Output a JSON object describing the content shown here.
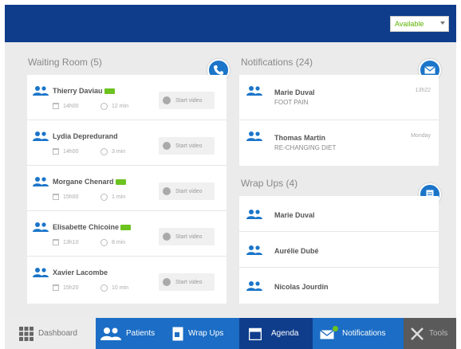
{
  "topbar": {
    "status_value": "Available"
  },
  "waiting_room": {
    "title": "Waiting Room (5)",
    "start_label": "Start video",
    "patients": [
      {
        "name": "Thierry Daviau",
        "new": true,
        "time": "14h00",
        "wait": "12 min"
      },
      {
        "name": "Lydia Depredurand",
        "new": false,
        "time": "14h00",
        "wait": "3 min"
      },
      {
        "name": "Morgane Chenard",
        "new": true,
        "time": "15h00",
        "wait": "1 min"
      },
      {
        "name": "Elisabette Chicoine",
        "new": true,
        "time": "13h10",
        "wait": "8 min"
      },
      {
        "name": "Xavier Lacombe",
        "new": false,
        "time": "15h20",
        "wait": "10 min"
      }
    ]
  },
  "notifications": {
    "title": "Notifications (24)",
    "items": [
      {
        "name": "Marie Duval",
        "detail": "FOOT PAIN",
        "time": "13h22"
      },
      {
        "name": "Thomas Martin",
        "detail": "RE-CHANGING DIET",
        "time": "Monday"
      }
    ]
  },
  "wrapups": {
    "title": "Wrap Ups (4)",
    "items": [
      {
        "name": "Marie Duval"
      },
      {
        "name": "Aurélie Dubé"
      },
      {
        "name": "Nicolas Jourdin"
      }
    ]
  },
  "tabs": {
    "dashboard": "Dashboard",
    "patients": "Patients",
    "wrapups": "Wrap Ups",
    "agenda": "Agenda",
    "notifications": "Notifications",
    "tools": "Tools"
  },
  "colors": {
    "topbar": "#0f3d8c",
    "tab_blue": "#1b6dc5",
    "tab_dark": "#0f3d8c",
    "accent": "#1b75c9",
    "badge_green": "#6cc21f"
  }
}
